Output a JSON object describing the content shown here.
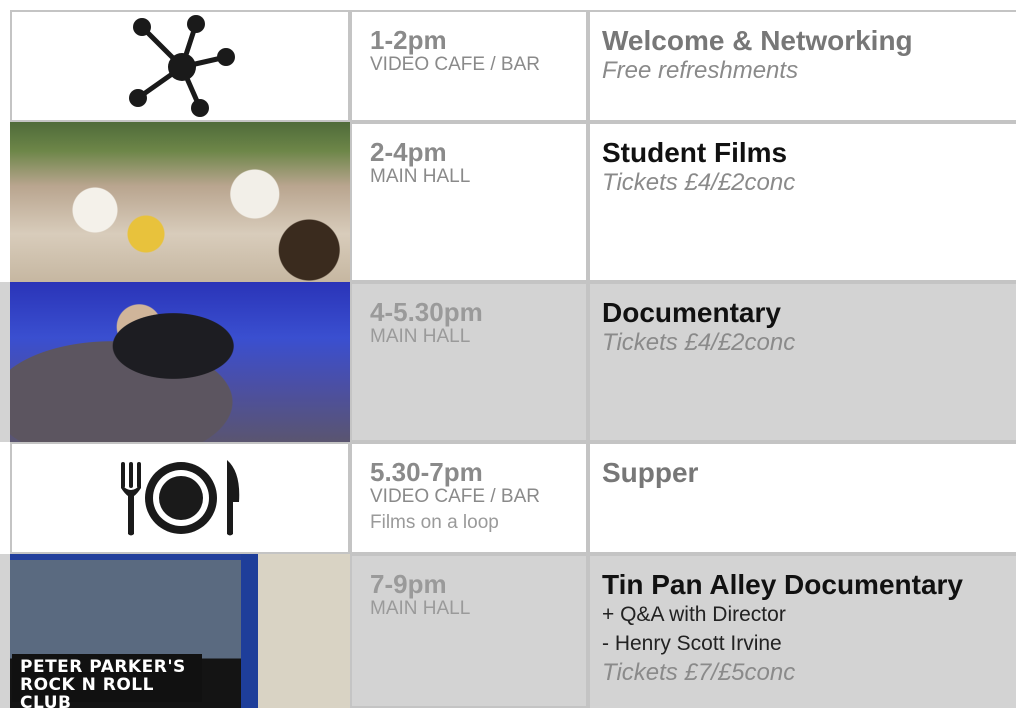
{
  "rows": [
    {
      "image": "network-icon",
      "time": "1-2pm",
      "venue": "VIDEO CAFE / BAR",
      "title": "Welcome & Networking",
      "title_color": "#777777",
      "sub": "Free refreshments"
    },
    {
      "image": "festival-photo",
      "time": "2-4pm",
      "venue": "MAIN HALL",
      "title": "Student Films",
      "title_color": "#111111",
      "sub": "Tickets £4/£2conc"
    },
    {
      "image": "diver-photo",
      "time": "4-5.30pm",
      "venue": "MAIN HALL",
      "title": "Documentary",
      "title_color": "#111111",
      "sub": "Tickets £4/£2conc",
      "background": "#d3d3d3"
    },
    {
      "image": "dinner-icon",
      "time": "5.30-7pm",
      "venue": "VIDEO CAFE / BAR",
      "note": "Films on a loop",
      "title": "Supper",
      "title_color": "#777777"
    },
    {
      "image": "shop-photo",
      "time": "7-9pm",
      "venue": "MAIN HALL",
      "title": "Tin Pan Alley Documentary",
      "title_color": "#111111",
      "lines": [
        "+ Q&A with Director",
        "- Henry Scott Irvine"
      ],
      "sub": "Tickets £7/£5conc",
      "background": "#d3d3d3",
      "sign_text": "PETER PARKER'S ROCK N ROLL CLUB"
    }
  ]
}
